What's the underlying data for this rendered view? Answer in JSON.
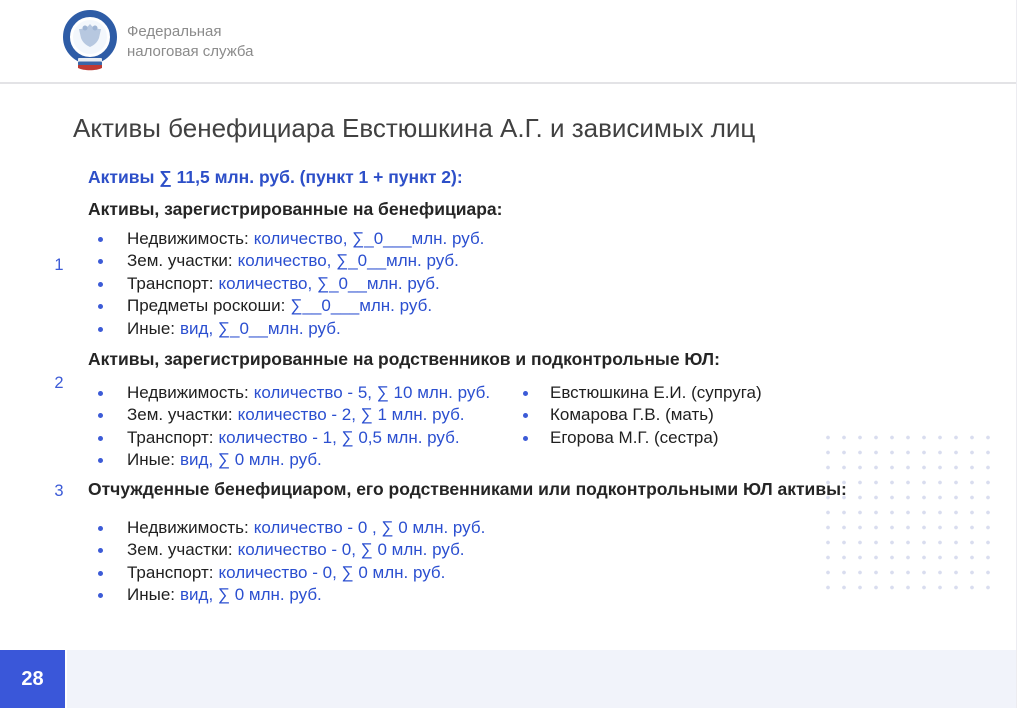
{
  "header": {
    "logo_icon": "fns-emblem",
    "org_name_line1": "Федеральная",
    "org_name_line2": "налоговая служба"
  },
  "slide": {
    "title": "Активы бенефициара Евстюшкина А.Г. и зависимых лиц",
    "summary": "Активы ∑ 11,5 млн. руб. (пункт 1 + пункт 2):",
    "sections": [
      {
        "number": "1",
        "heading": "Активы, зарегистрированные на бенефициара:",
        "items": [
          {
            "label": "Недвижимость:",
            "value": "количество, ∑_0___млн. руб."
          },
          {
            "label": "Зем. участки:",
            "value": "количество, ∑_0__млн. руб."
          },
          {
            "label": "Транспорт:",
            "value": "количество, ∑_0__млн. руб."
          },
          {
            "label": "Предметы роскоши:",
            "value": "∑__0___млн. руб."
          },
          {
            "label": "Иные:",
            "value": "вид, ∑_0__млн. руб."
          }
        ]
      },
      {
        "number": "2",
        "heading": "Активы, зарегистрированные на родственников и подконтрольные ЮЛ:",
        "items": [
          {
            "label": "Недвижимость:",
            "value": "количество - 5, ∑ 10 млн. руб."
          },
          {
            "label": "Зем. участки:",
            "value": "количество - 2, ∑ 1 млн. руб."
          },
          {
            "label": "Транспорт:",
            "value": "количество - 1, ∑ 0,5 млн. руб."
          },
          {
            "label": "Иные:",
            "value": "вид, ∑ 0 млн. руб."
          }
        ],
        "relatives": [
          {
            "name": "Евстюшкина Е.И. (супруга)"
          },
          {
            "name": "Комарова Г.В. (мать)"
          },
          {
            "name": "Егорова М.Г. (сестра)"
          }
        ]
      },
      {
        "number": "3",
        "heading": "Отчужденные бенефициаром, его родственниками или подконтрольными ЮЛ активы:",
        "items": [
          {
            "label": "Недвижимость:",
            "value": "количество - 0 , ∑ 0 млн. руб."
          },
          {
            "label": "Зем. участки:",
            "value": "количество - 0, ∑ 0 млн. руб."
          },
          {
            "label": "Транспорт:",
            "value": "количество - 0, ∑ 0 млн. руб."
          },
          {
            "label": "Иные:",
            "value": "вид, ∑ 0 млн. руб."
          }
        ]
      }
    ]
  },
  "footer": {
    "page_number": "28"
  },
  "colors": {
    "accent_blue": "#2d4fc8",
    "value_blue": "#2b4fd0",
    "marker_blue": "#3c5bd7",
    "footer_badge_blue": "#3a57d9",
    "footer_bar": "#f1f3fa",
    "text_dark": "#252525",
    "title_gray": "#414141",
    "org_gray": "#8b8b8b",
    "dot_grid": "#d9ddef"
  }
}
